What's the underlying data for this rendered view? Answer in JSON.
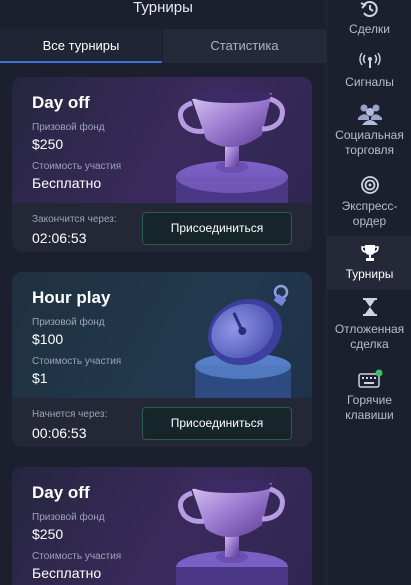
{
  "panel": {
    "title": "Турниры",
    "tabs": [
      {
        "label": "Все турниры",
        "active": true
      },
      {
        "label": "Статистика",
        "active": false
      }
    ]
  },
  "tournaments": [
    {
      "name": "Day off",
      "prize_label": "Призовой фонд",
      "prize": "$250",
      "fee_label": "Стоимость участия",
      "fee": "Бесплатно",
      "timer_label": "Закончится через:",
      "timer": "02:06:53",
      "button": "Присоединиться",
      "art": "trophy-icon"
    },
    {
      "name": "Hour play",
      "prize_label": "Призовой фонд",
      "prize": "$100",
      "fee_label": "Стоимость участия",
      "fee": "$1",
      "timer_label": "Начнется через:",
      "timer": "00:06:53",
      "button": "Присоединиться",
      "art": "stopwatch-icon"
    },
    {
      "name": "Day off",
      "prize_label": "Призовой фонд",
      "prize": "$250",
      "fee_label": "Стоимость участия",
      "fee": "Бесплатно",
      "art": "trophy-icon"
    }
  ],
  "sidebar": {
    "items": [
      {
        "label": "Сделки",
        "icon": "history-icon"
      },
      {
        "label": "Сигналы",
        "icon": "signal-icon"
      },
      {
        "label": "Социальная торговля",
        "icon": "users-icon"
      },
      {
        "label": "Экспресс-ордер",
        "icon": "target-icon"
      },
      {
        "label": "Турниры",
        "icon": "trophy-icon",
        "active": true
      },
      {
        "label": "Отложенная сделка",
        "icon": "hourglass-icon"
      },
      {
        "label": "Горячие клавиши",
        "icon": "keyboard-icon"
      }
    ]
  },
  "colors": {
    "background": "#1c1f2d",
    "accent_tab": "#3d71d9",
    "button_border": "#2a5b4f",
    "online_dot": "#35c46a"
  }
}
